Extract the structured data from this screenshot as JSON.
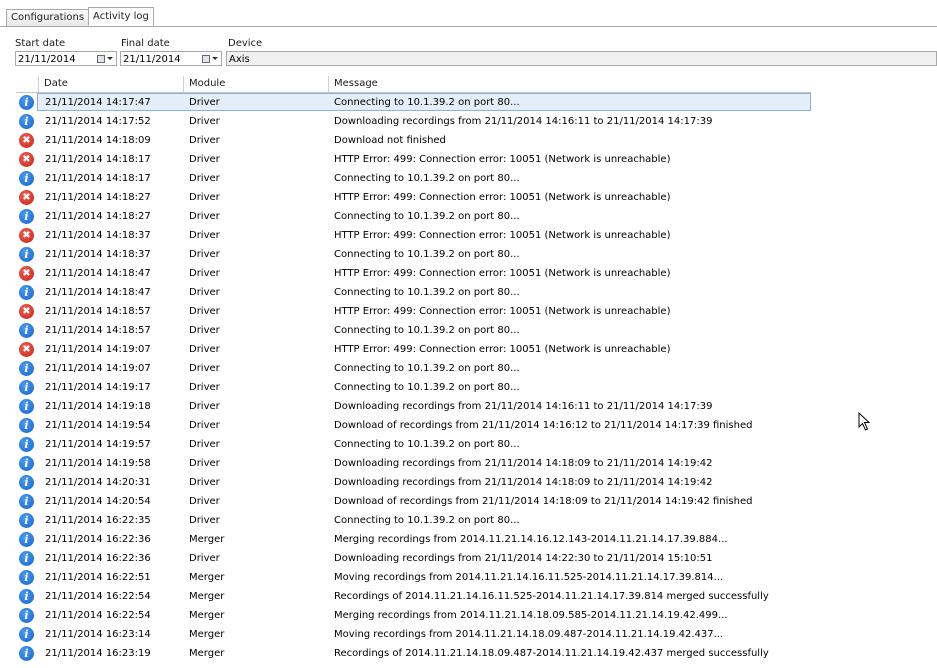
{
  "tabs": [
    {
      "label": "Configurations",
      "active": false
    },
    {
      "label": "Activity log",
      "active": true
    }
  ],
  "filters": {
    "start_date_label": "Start date",
    "start_date_value": "21/11/2014",
    "final_date_label": "Final date",
    "final_date_value": "21/11/2014",
    "device_label": "Device",
    "device_value": "Axis"
  },
  "columns": {
    "date": "Date",
    "module": "Module",
    "message": "Message"
  },
  "colors": {
    "info": "#1662c8",
    "error": "#c22418",
    "selection": "#e4eef9"
  },
  "rows": [
    {
      "type": "info",
      "date": "21/11/2014 14:17:47",
      "module": "Driver",
      "message": "Connecting to 10.1.39.2 on port 80...",
      "selected": true
    },
    {
      "type": "info",
      "date": "21/11/2014 14:17:52",
      "module": "Driver",
      "message": "Downloading recordings from 21/11/2014 14:16:11 to 21/11/2014 14:17:39"
    },
    {
      "type": "error",
      "date": "21/11/2014 14:18:09",
      "module": "Driver",
      "message": "Download not finished"
    },
    {
      "type": "error",
      "date": "21/11/2014 14:18:17",
      "module": "Driver",
      "message": "HTTP Error: 499: Connection error: 10051 (Network is unreachable)"
    },
    {
      "type": "info",
      "date": "21/11/2014 14:18:17",
      "module": "Driver",
      "message": "Connecting to 10.1.39.2 on port 80..."
    },
    {
      "type": "error",
      "date": "21/11/2014 14:18:27",
      "module": "Driver",
      "message": "HTTP Error: 499: Connection error: 10051 (Network is unreachable)"
    },
    {
      "type": "info",
      "date": "21/11/2014 14:18:27",
      "module": "Driver",
      "message": "Connecting to 10.1.39.2 on port 80..."
    },
    {
      "type": "error",
      "date": "21/11/2014 14:18:37",
      "module": "Driver",
      "message": "HTTP Error: 499: Connection error: 10051 (Network is unreachable)"
    },
    {
      "type": "info",
      "date": "21/11/2014 14:18:37",
      "module": "Driver",
      "message": "Connecting to 10.1.39.2 on port 80..."
    },
    {
      "type": "error",
      "date": "21/11/2014 14:18:47",
      "module": "Driver",
      "message": "HTTP Error: 499: Connection error: 10051 (Network is unreachable)"
    },
    {
      "type": "info",
      "date": "21/11/2014 14:18:47",
      "module": "Driver",
      "message": "Connecting to 10.1.39.2 on port 80..."
    },
    {
      "type": "error",
      "date": "21/11/2014 14:18:57",
      "module": "Driver",
      "message": "HTTP Error: 499: Connection error: 10051 (Network is unreachable)"
    },
    {
      "type": "info",
      "date": "21/11/2014 14:18:57",
      "module": "Driver",
      "message": "Connecting to 10.1.39.2 on port 80..."
    },
    {
      "type": "error",
      "date": "21/11/2014 14:19:07",
      "module": "Driver",
      "message": "HTTP Error: 499: Connection error: 10051 (Network is unreachable)"
    },
    {
      "type": "info",
      "date": "21/11/2014 14:19:07",
      "module": "Driver",
      "message": "Connecting to 10.1.39.2 on port 80..."
    },
    {
      "type": "info",
      "date": "21/11/2014 14:19:17",
      "module": "Driver",
      "message": "Connecting to 10.1.39.2 on port 80..."
    },
    {
      "type": "info",
      "date": "21/11/2014 14:19:18",
      "module": "Driver",
      "message": "Downloading recordings from 21/11/2014 14:16:11 to 21/11/2014 14:17:39"
    },
    {
      "type": "info",
      "date": "21/11/2014 14:19:54",
      "module": "Driver",
      "message": "Download of recordings from 21/11/2014 14:16:12 to 21/11/2014 14:17:39 finished"
    },
    {
      "type": "info",
      "date": "21/11/2014 14:19:57",
      "module": "Driver",
      "message": "Connecting to 10.1.39.2 on port 80..."
    },
    {
      "type": "info",
      "date": "21/11/2014 14:19:58",
      "module": "Driver",
      "message": "Downloading recordings from 21/11/2014 14:18:09 to 21/11/2014 14:19:42"
    },
    {
      "type": "info",
      "date": "21/11/2014 14:20:31",
      "module": "Driver",
      "message": "Downloading recordings from 21/11/2014 14:18:09 to 21/11/2014 14:19:42"
    },
    {
      "type": "info",
      "date": "21/11/2014 14:20:54",
      "module": "Driver",
      "message": "Download of recordings from 21/11/2014 14:18:09 to 21/11/2014 14:19:42 finished"
    },
    {
      "type": "info",
      "date": "21/11/2014 16:22:35",
      "module": "Driver",
      "message": "Connecting to 10.1.39.2 on port 80..."
    },
    {
      "type": "info",
      "date": "21/11/2014 16:22:36",
      "module": "Merger",
      "message": "Merging recordings from 2014.11.21.14.16.12.143-2014.11.21.14.17.39.884..."
    },
    {
      "type": "info",
      "date": "21/11/2014 16:22:36",
      "module": "Driver",
      "message": "Downloading recordings from 21/11/2014 14:22:30 to 21/11/2014 15:10:51"
    },
    {
      "type": "info",
      "date": "21/11/2014 16:22:51",
      "module": "Merger",
      "message": "Moving recordings from 2014.11.21.14.16.11.525-2014.11.21.14.17.39.814..."
    },
    {
      "type": "info",
      "date": "21/11/2014 16:22:54",
      "module": "Merger",
      "message": "Recordings of 2014.11.21.14.16.11.525-2014.11.21.14.17.39.814 merged successfully"
    },
    {
      "type": "info",
      "date": "21/11/2014 16:22:54",
      "module": "Merger",
      "message": "Merging recordings from 2014.11.21.14.18.09.585-2014.11.21.14.19.42.499..."
    },
    {
      "type": "info",
      "date": "21/11/2014 16:23:14",
      "module": "Merger",
      "message": "Moving recordings from 2014.11.21.14.18.09.487-2014.11.21.14.19.42.437..."
    },
    {
      "type": "info",
      "date": "21/11/2014 16:23:19",
      "module": "Merger",
      "message": "Recordings of 2014.11.21.14.18.09.487-2014.11.21.14.19.42.437 merged successfully"
    }
  ]
}
